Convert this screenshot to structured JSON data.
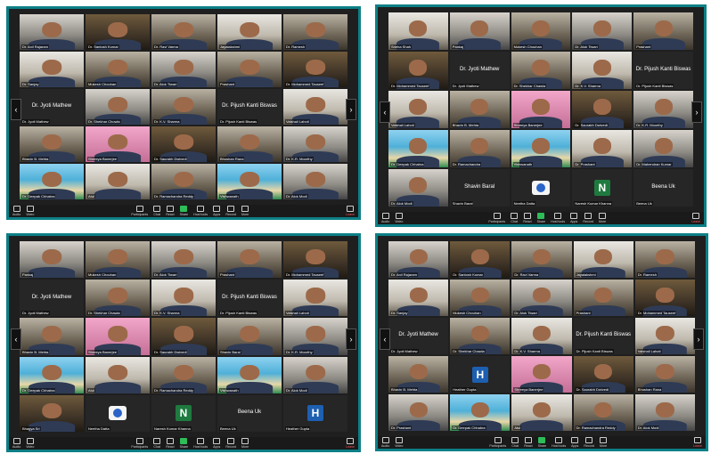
{
  "panels": [
    {
      "tiles": [
        {
          "name": "Dr. Anil Rajaram",
          "tone": "cam2"
        },
        {
          "name": "Dr. Santosh Kumar",
          "tone": "cam3"
        },
        {
          "name": "Dr. Ravi Varma",
          "tone": "cam"
        },
        {
          "name": "Jayalakshmi",
          "tone": "cam4"
        },
        {
          "name": "Dr. Ramesh",
          "tone": "cam"
        },
        {
          "name": "Dr. Sanjay",
          "tone": "cam4"
        },
        {
          "name": "Mukesh Chouhan",
          "tone": "cam"
        },
        {
          "name": "Dr. Alok Tiwari",
          "tone": "cam2"
        },
        {
          "name": "Prashant",
          "tone": "cam"
        },
        {
          "name": "Dr. Mohammed Tauseef",
          "tone": "cam3"
        },
        {
          "name": "Dr. Jyoti Mathew",
          "tone": "dark",
          "big": "Dr. Jyoti Mathew"
        },
        {
          "name": "Dr. Shekhar Chowla",
          "tone": "cam2"
        },
        {
          "name": "Dr. K.V. Sharma",
          "tone": "cam"
        },
        {
          "name": "Dr. Pijush Kanti Biswas",
          "tone": "dark",
          "big": "Dr. Pijush Kanti Biswas"
        },
        {
          "name": "Vaishali Lahoti",
          "tone": "cam4"
        },
        {
          "name": "Bhavin B. Mehta",
          "tone": "cam"
        },
        {
          "name": "Shreeya Banerjee",
          "tone": "pink"
        },
        {
          "name": "Dr. Saurabh Dwivedi",
          "tone": "cam3"
        },
        {
          "name": "Bhushan Rana",
          "tone": "cam"
        },
        {
          "name": "Dr. K.R. Moorthy",
          "tone": "cam2"
        },
        {
          "name": "Dr. Deepak Chhabra",
          "tone": "beach"
        },
        {
          "name": "Atul",
          "tone": "cam4"
        },
        {
          "name": "Dr. Ramachandra Reddy",
          "tone": "cam"
        },
        {
          "name": "Vishwanath",
          "tone": "beach"
        },
        {
          "name": "Dr. Alok Modi",
          "tone": "cam2"
        }
      ],
      "toolbar": {
        "audio": "Audio",
        "video": "Video",
        "participants": "Participants",
        "chat": "Chat",
        "react": "React",
        "share": "Share",
        "host": "Host tools",
        "apps": "Apps",
        "record": "Record",
        "more": "More",
        "leave": "Leave"
      }
    },
    {
      "tiles": [
        {
          "name": "Sneha Shah",
          "tone": "cam4"
        },
        {
          "name": "Pankaj",
          "tone": "cam2"
        },
        {
          "name": "Mukesh Chouhan",
          "tone": "cam"
        },
        {
          "name": "Dr. Alok Tiwari",
          "tone": "cam2"
        },
        {
          "name": "Prashant",
          "tone": "cam"
        },
        {
          "name": "Dr. Mohammed Tauseef",
          "tone": "cam3"
        },
        {
          "name": "Dr. Jyoti Mathew",
          "tone": "dark",
          "big": "Dr. Jyoti Mathew"
        },
        {
          "name": "Dr. Shekhar Chawla",
          "tone": "cam"
        },
        {
          "name": "Dr. K.V. Sharma",
          "tone": "cam4"
        },
        {
          "name": "Dr. Pijush Kanti Biswas",
          "tone": "dark",
          "big": "Dr. Pijush Kanti Biswas"
        },
        {
          "name": "Vaishali Lahoti",
          "tone": "cam4"
        },
        {
          "name": "Bhavin B. Mehta",
          "tone": "cam"
        },
        {
          "name": "Shreeya Banerjee",
          "tone": "pink"
        },
        {
          "name": "Dr. Saurabh Dwivedi",
          "tone": "cam3"
        },
        {
          "name": "Dr. K.R. Moorthy",
          "tone": "cam2"
        },
        {
          "name": "Dr. Deepak Chhabra",
          "tone": "beach"
        },
        {
          "name": "Dr. Ramachandra",
          "tone": "cam"
        },
        {
          "name": "Vishwanath",
          "tone": "beach"
        },
        {
          "name": "Dr. Prashant",
          "tone": "cam4"
        },
        {
          "name": "Dr. Mahendran Kumar",
          "tone": "cam2"
        },
        {
          "name": "Dr. Alok Modi",
          "tone": "cam2"
        },
        {
          "name": "Shavin Baral",
          "tone": "dark",
          "big": "Shavin Baral"
        },
        {
          "name": "Neetha Datta",
          "tone": "dark",
          "logo": true
        },
        {
          "name": "Naresh Kumar Khanna",
          "tone": "dark",
          "letter": "N",
          "letter_color": "#1f7a3f"
        },
        {
          "name": "Beena Uk",
          "tone": "dark",
          "big": "Beena Uk"
        }
      ],
      "toolbar": {
        "audio": "Audio",
        "video": "Video",
        "participants": "Participants",
        "chat": "Chat",
        "react": "React",
        "share": "Share",
        "host": "Host tools",
        "apps": "Apps",
        "record": "Record",
        "more": "More",
        "leave": "Leave"
      }
    },
    {
      "tiles": [
        {
          "name": "Pankaj",
          "tone": "cam2"
        },
        {
          "name": "Mukesh Chouhan",
          "tone": "cam"
        },
        {
          "name": "Dr. Alok Tiwari",
          "tone": "cam2"
        },
        {
          "name": "Prashant",
          "tone": "cam"
        },
        {
          "name": "Dr. Mohammed Tauseef",
          "tone": "cam3"
        },
        {
          "name": "Dr. Jyoti Mathew",
          "tone": "dark",
          "big": "Dr. Jyoti Mathew"
        },
        {
          "name": "Dr. Shekhar Chawla",
          "tone": "cam"
        },
        {
          "name": "Dr. K.V. Sharma",
          "tone": "cam4"
        },
        {
          "name": "Dr. Pijush Kanti Biswas",
          "tone": "dark",
          "big": "Dr. Pijush Kanti Biswas"
        },
        {
          "name": "Vaishali Lahoti",
          "tone": "cam4"
        },
        {
          "name": "Bhavin B. Mehta",
          "tone": "cam"
        },
        {
          "name": "Shreeya Banerjee",
          "tone": "pink"
        },
        {
          "name": "Dr. Saurabh Dwivedi",
          "tone": "cam3"
        },
        {
          "name": "Shavin Baral",
          "tone": "cam"
        },
        {
          "name": "Dr. K.R. Moorthy",
          "tone": "cam2"
        },
        {
          "name": "Dr. Deepak Chhabra",
          "tone": "beach"
        },
        {
          "name": "Atul",
          "tone": "cam4"
        },
        {
          "name": "Dr. Ramachandra Reddy",
          "tone": "cam"
        },
        {
          "name": "Vishwanath",
          "tone": "beach"
        },
        {
          "name": "Dr. Alok Modi",
          "tone": "cam2"
        },
        {
          "name": "Bhagya Sri",
          "tone": "cam3"
        },
        {
          "name": "Neetha Datta",
          "tone": "dark",
          "logo": true
        },
        {
          "name": "Naresh Kumar Khanna",
          "tone": "dark",
          "letter": "N",
          "letter_color": "#1f7a3f"
        },
        {
          "name": "Beena Uk",
          "tone": "dark",
          "big": "Beena Uk"
        },
        {
          "name": "Heather Gupta",
          "tone": "dark",
          "letter": "H",
          "letter_color": "#1d5fb0"
        }
      ],
      "toolbar": {
        "audio": "Audio",
        "video": "Video",
        "participants": "Participants",
        "chat": "Chat",
        "react": "React",
        "share": "Share",
        "host": "Host tools",
        "apps": "Apps",
        "record": "Record",
        "more": "More",
        "leave": "Leave"
      }
    },
    {
      "tiles": [
        {
          "name": "Dr. Anil Rajaram",
          "tone": "cam2"
        },
        {
          "name": "Dr. Santosh Kumar",
          "tone": "cam3"
        },
        {
          "name": "Dr. Ravi Varma",
          "tone": "cam"
        },
        {
          "name": "Jayalakshmi",
          "tone": "cam4"
        },
        {
          "name": "Dr. Ramesh",
          "tone": "cam"
        },
        {
          "name": "Dr. Sanjay",
          "tone": "cam4"
        },
        {
          "name": "Mukesh Chouhan",
          "tone": "cam"
        },
        {
          "name": "Dr. Alok Tiwari",
          "tone": "cam2"
        },
        {
          "name": "Prashant",
          "tone": "cam"
        },
        {
          "name": "Dr. Mohammed Tauseef",
          "tone": "cam3"
        },
        {
          "name": "Dr. Jyoti Mathew",
          "tone": "dark",
          "big": "Dr. Jyoti Mathew"
        },
        {
          "name": "Dr. Shekhar Chawla",
          "tone": "cam"
        },
        {
          "name": "Dr. K.V. Sharma",
          "tone": "cam4"
        },
        {
          "name": "Dr. Pijush Kanti Biswas",
          "tone": "dark",
          "big": "Dr. Pijush Kanti Biswas"
        },
        {
          "name": "Vaishali Lahoti",
          "tone": "cam4"
        },
        {
          "name": "Bhavin B. Mehta",
          "tone": "cam"
        },
        {
          "name": "Heather Gupta",
          "tone": "dark",
          "letter": "H",
          "letter_color": "#1d5fb0"
        },
        {
          "name": "Shreeya Banerjee",
          "tone": "pink"
        },
        {
          "name": "Dr. Saurabh Dwivedi",
          "tone": "cam3"
        },
        {
          "name": "Bhushan Rana",
          "tone": "cam"
        },
        {
          "name": "Dr. Prashant",
          "tone": "cam2"
        },
        {
          "name": "Dr. Deepak Chhabra",
          "tone": "beach"
        },
        {
          "name": "Atul",
          "tone": "cam4"
        },
        {
          "name": "Dr. Ramachandra Reddy",
          "tone": "cam"
        },
        {
          "name": "Dr. Alok Modi",
          "tone": "cam2"
        }
      ],
      "toolbar": {
        "audio": "Audio",
        "video": "Video",
        "participants": "Participants",
        "chat": "Chat",
        "react": "React",
        "share": "Share",
        "host": "Host tools",
        "apps": "Apps",
        "record": "Record",
        "more": "More",
        "leave": "Leave"
      }
    }
  ]
}
